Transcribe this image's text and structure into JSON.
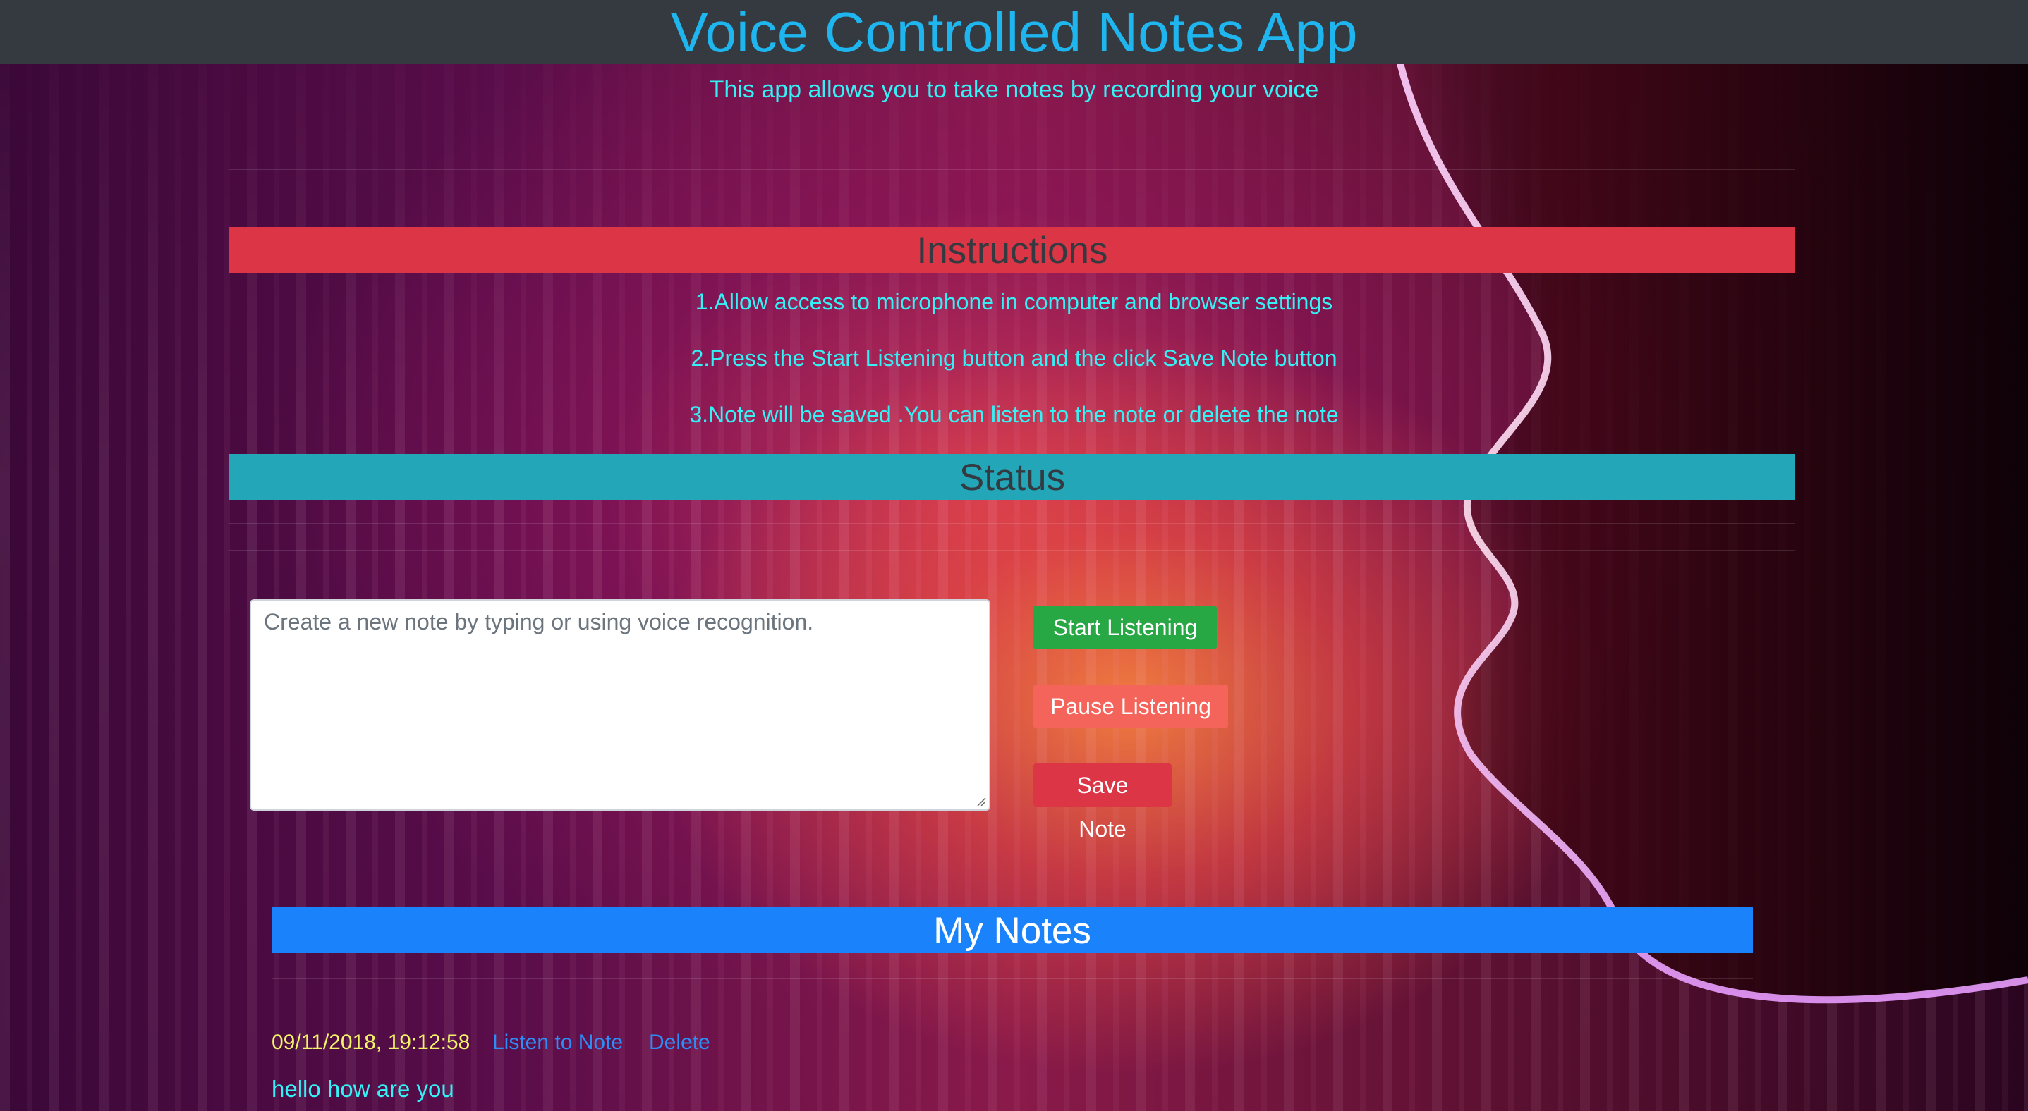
{
  "header": {
    "title": "Voice Controlled Notes App",
    "subtitle": "This app allows you to take notes by recording your voice"
  },
  "instructions": {
    "heading": "Instructions",
    "steps": [
      "1.Allow access to microphone in computer and browser settings",
      "2.Press the Start Listening button and the click Save Note button",
      "3.Note will be saved .You can listen to the note or delete the note"
    ]
  },
  "status": {
    "heading": "Status"
  },
  "note_editor": {
    "placeholder": "Create a new note by typing or using voice recognition.",
    "value": ""
  },
  "controls": {
    "start_label": "Start Listening",
    "pause_label": "Pause Listening",
    "save_label": "Save Note"
  },
  "notes": {
    "heading": "My Notes",
    "items": [
      {
        "date": "09/11/2018, 19:12:58",
        "listen_label": "Listen to Note",
        "delete_label": "Delete",
        "content": "hello how are you"
      }
    ]
  },
  "colors": {
    "navbar": "#343a40",
    "title": "#1fb6f0",
    "accent_text": "#35f0f5",
    "instructions_banner": "#dc3545",
    "status_banner": "#22a6b8",
    "notes_banner": "#1a82fb",
    "start_button": "#28a745",
    "pause_button": "#f5645a",
    "save_button": "#dc3545",
    "note_date": "#f3f36a",
    "link": "#2e8df5"
  }
}
